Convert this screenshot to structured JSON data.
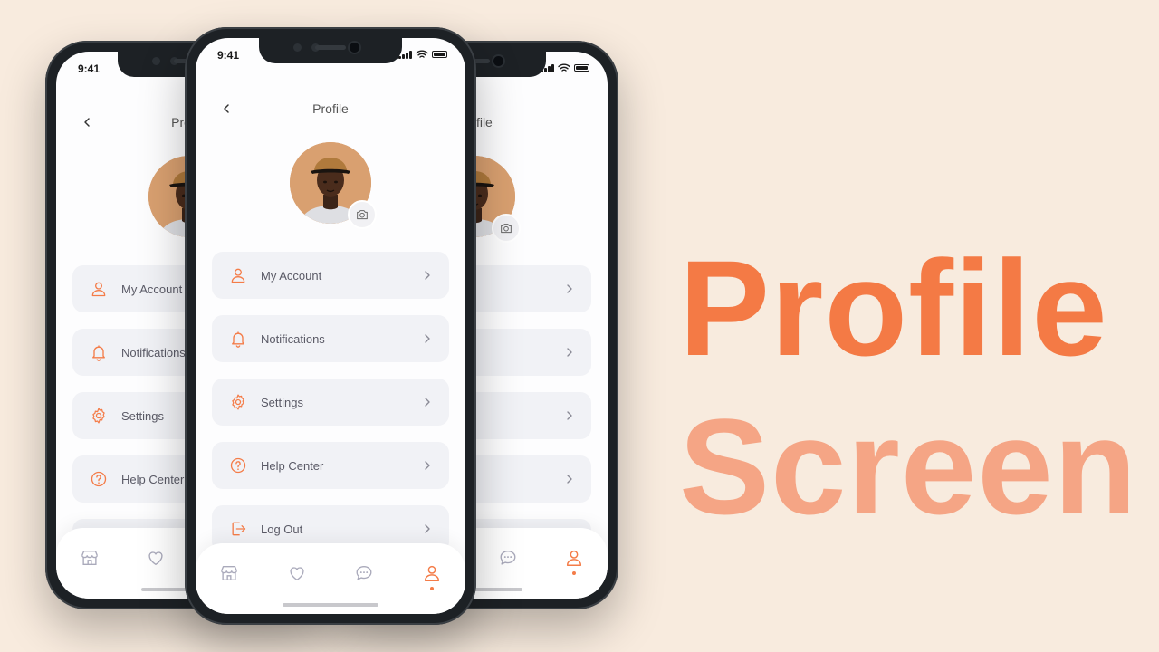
{
  "status": {
    "time": "9:41"
  },
  "screen": {
    "title": "Profile"
  },
  "menu": {
    "items": [
      {
        "label": "My Account",
        "icon": "user-icon"
      },
      {
        "label": "Notifications",
        "icon": "bell-icon"
      },
      {
        "label": "Settings",
        "icon": "gear-icon"
      },
      {
        "label": "Help Center",
        "icon": "help-icon"
      },
      {
        "label": "Log Out",
        "icon": "logout-icon"
      }
    ]
  },
  "tabs": [
    {
      "name": "store",
      "icon": "store-icon"
    },
    {
      "name": "favorites",
      "icon": "heart-icon"
    },
    {
      "name": "chat",
      "icon": "chat-icon"
    },
    {
      "name": "profile",
      "icon": "user-icon",
      "active": true
    }
  ],
  "headline": {
    "line1": "Profile",
    "line2": "Screen"
  },
  "colors": {
    "accent": "#f47c48",
    "accent_light": "#f5a585",
    "background": "#f8ebde"
  }
}
